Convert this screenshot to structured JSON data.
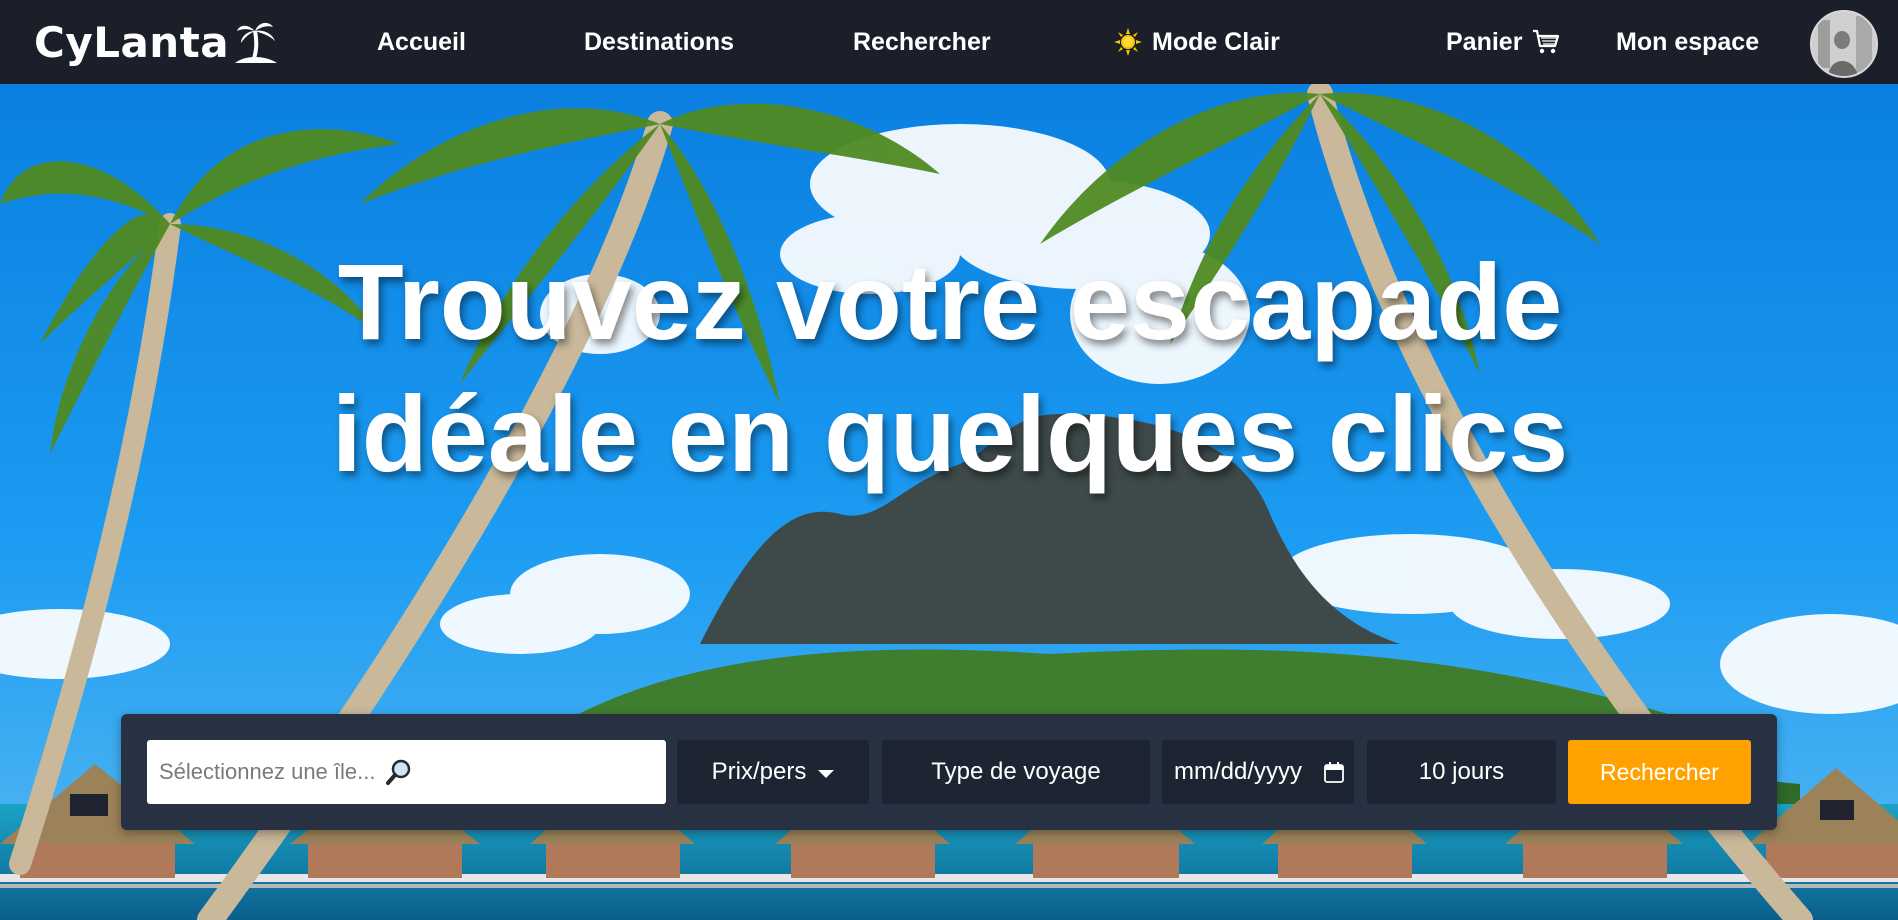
{
  "brand": {
    "name": "CyLanta"
  },
  "nav": {
    "home": "Accueil",
    "destinations": "Destinations",
    "search": "Rechercher",
    "mode": "Mode Clair",
    "cart": "Panier",
    "account": "Mon espace"
  },
  "hero": {
    "title_line1": "Trouvez votre escapade",
    "title_line2": "idéale en quelques clics"
  },
  "search": {
    "island_placeholder": "Sélectionnez une île...",
    "price_label": "Prix/pers",
    "trip_type": "Type de voyage",
    "date_placeholder": "mm/dd/yyyy",
    "duration": "10 jours",
    "submit": "Rechercher"
  },
  "icons": {
    "logo": "palm-tree-icon",
    "mode": "sun-icon",
    "cart": "shopping-cart-icon",
    "search": "magnifier-icon",
    "price_dropdown": "caret-down-icon",
    "date": "calendar-icon"
  },
  "colors": {
    "navbar": "#1b1f2a",
    "panel": "#283141",
    "field": "#1e2532",
    "accent": "#ffa200"
  }
}
